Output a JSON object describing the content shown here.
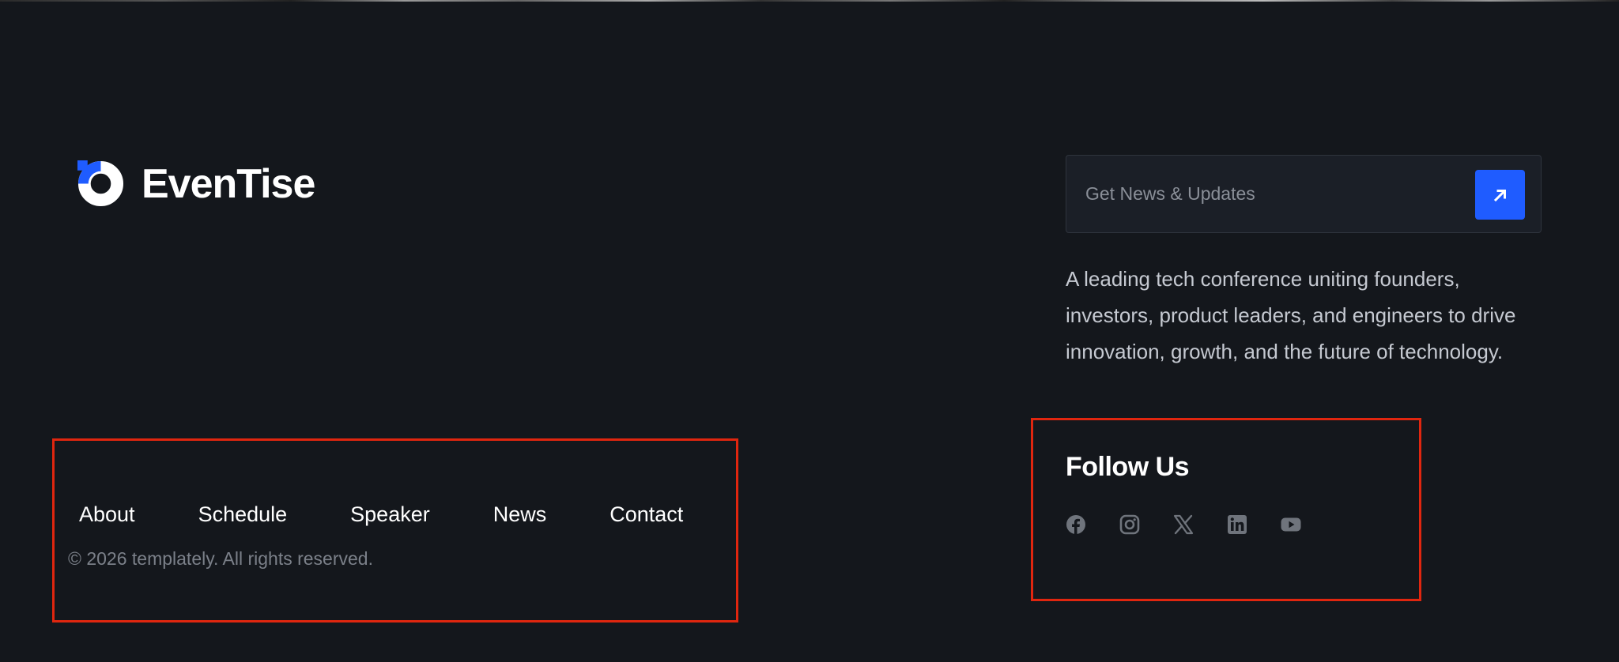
{
  "brand": {
    "name": "EvenTise",
    "mark_icon": "ring-logo-icon",
    "accent_color": "#1f5cff"
  },
  "newsletter": {
    "placeholder": "Get News & Updates",
    "submit_icon": "arrow-up-right-icon"
  },
  "description": "A leading tech conference uniting founders, investors, product leaders, and engineers to drive innovation, growth, and the future of technology.",
  "follow": {
    "title": "Follow Us",
    "icons": [
      "facebook-icon",
      "instagram-icon",
      "x-twitter-icon",
      "linkedin-icon",
      "youtube-icon"
    ]
  },
  "nav": {
    "items": [
      "About",
      "Schedule",
      "Speaker",
      "News",
      "Contact"
    ]
  },
  "copyright": "© 2026 templately. All rights reserved.",
  "colors": {
    "background": "#14171c",
    "highlight_border": "#e0260f",
    "icon_gray": "#6f747c"
  }
}
